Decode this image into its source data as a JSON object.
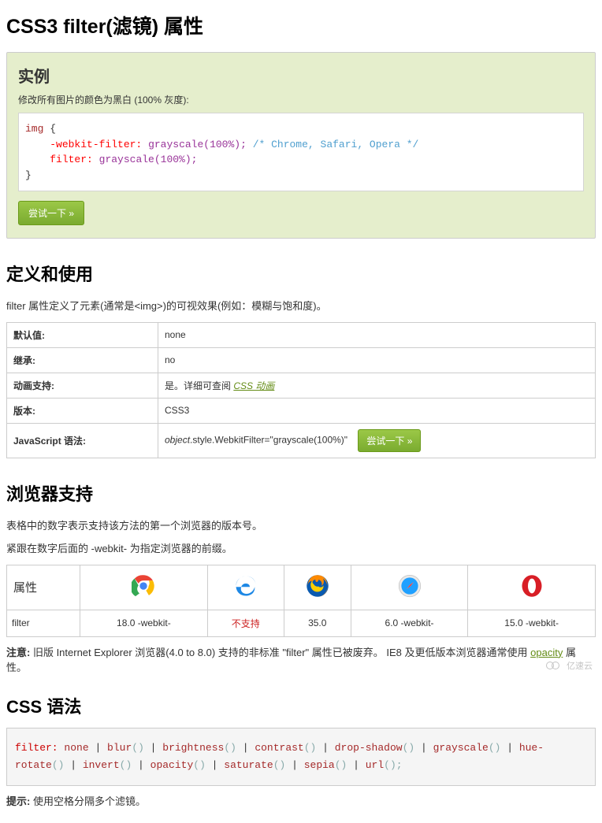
{
  "page_title": "CSS3 filter(滤镜) 属性",
  "example": {
    "heading": "实例",
    "desc": "修改所有图片的颜色为黑白 (100% 灰度):",
    "code": {
      "selector": "img",
      "open": "{",
      "prop1": "-webkit-filter:",
      "val1": "grayscale(100%);",
      "comment": "/* Chrome, Safari, Opera */",
      "prop2": "filter:",
      "val2": "grayscale(100%);",
      "close": "}"
    },
    "try_btn": "尝试一下 »"
  },
  "definition": {
    "heading": "定义和使用",
    "text": "filter 属性定义了元素(通常是<img>)的可视效果(例如：模糊与饱和度)。",
    "rows": {
      "default_label": "默认值:",
      "default_val": "none",
      "inherit_label": "继承:",
      "inherit_val": "no",
      "anim_label": "动画支持:",
      "anim_prefix": "是。详细可查阅 ",
      "anim_link": "CSS 动画",
      "version_label": "版本:",
      "version_val": "CSS3",
      "js_label": "JavaScript 语法:",
      "js_obj": "object",
      "js_rest": ".style.WebkitFilter=\"grayscale(100%)\"",
      "js_try": "尝试一下 »"
    }
  },
  "browser": {
    "heading": "浏览器支持",
    "p1": "表格中的数字表示支持该方法的第一个浏览器的版本号。",
    "p2": "紧跟在数字后面的 -webkit- 为指定浏览器的前缀。",
    "attr_header": "属性",
    "row_label": "filter",
    "cells": {
      "chrome": "18.0 -webkit-",
      "ie": "不支持",
      "firefox": "35.0",
      "safari": "6.0 -webkit-",
      "opera": "15.0 -webkit-"
    },
    "note_label": "注意:",
    "note_text_a": " 旧版 Internet Explorer 浏览器(4.0 to 8.0) 支持的非标准 \"filter\" 属性已被废弃。 IE8 及更低版本浏览器通常使用 ",
    "note_link": "opacity",
    "note_text_b": " 属性。"
  },
  "css_syntax": {
    "heading": "CSS 语法",
    "code": {
      "prop": "filter:",
      "tokens": "none | blur() | brightness() | contrast() | drop-shadow() | grayscale() | hue-rotate() | invert() | opacity() | saturate() | sepia() | url();",
      "t": [
        "none",
        " | ",
        "blur",
        "()",
        " | ",
        "brightness",
        "()",
        " | ",
        "contrast",
        "()",
        " | ",
        "drop-shadow",
        "()",
        " | ",
        "grayscale",
        "()",
        " | ",
        "hue-rotate",
        "()",
        " | ",
        "invert",
        "()",
        " | ",
        "opacity",
        "()",
        " | ",
        "saturate",
        "()",
        " | ",
        "sepia",
        "()",
        " | ",
        "url",
        "();"
      ]
    },
    "tip_label": "提示:",
    "tip_text": " 使用空格分隔多个滤镜。"
  },
  "watermark": "亿速云"
}
